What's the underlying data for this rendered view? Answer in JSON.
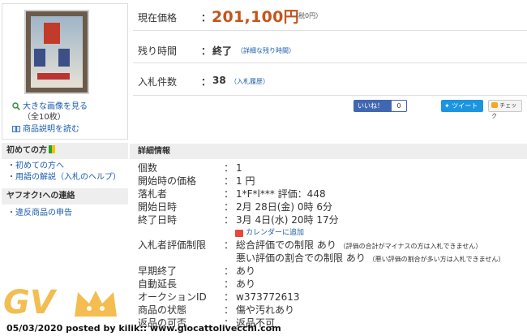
{
  "left": {
    "view_large_image": "大きな画像を見る",
    "view_large_image_count": "（全10枚）",
    "read_description": "商品説明を読む",
    "beginner": {
      "title": "初めての方",
      "items": [
        "初めての方へ",
        "用語の解説（入札のヘルプ）"
      ]
    },
    "contact": {
      "title": "ヤフオク!への連絡",
      "items": [
        "違反商品の申告"
      ]
    }
  },
  "summary": {
    "price_label": "現在価格",
    "price_value": "201,100円",
    "price_tax": "（税0円）",
    "time_label": "残り時間",
    "time_value": "終了",
    "time_detail": "（詳細な残り時間）",
    "bids_label": "入札件数",
    "bids_value": "38",
    "bids_history": "（入札履歴）"
  },
  "social": {
    "like_label": "いいね！",
    "like_count": "0",
    "tweet_label": "ツイート",
    "check_label": "チェック"
  },
  "detail": {
    "title": "詳細情報",
    "quantity_label": "個数",
    "quantity_value": "1",
    "start_price_label": "開始時の価格",
    "start_price_value": "1 円",
    "winner_label": "落札者",
    "winner_value": "1*F*l*** 評価：448",
    "start_date_label": "開始日時",
    "start_date_value": "2月 28日(金) 0時 6分",
    "end_date_label": "終了日時",
    "end_date_value": "3月 4日(水) 20時 17分",
    "calendar_link": "カレンダーに追加",
    "rating_limit_label": "入札者評価制限",
    "rating_limit_1": "総合評価での制限 あり",
    "rating_limit_1_note": "（評価の合計がマイナスの方は入札できません）",
    "rating_limit_2": "悪い評価の割合での制限 あり",
    "rating_limit_2_note": "（悪い評価の割合が多い方は入札できません）",
    "early_end_label": "早期終了",
    "early_end_value": "あり",
    "auto_extend_label": "自動延長",
    "auto_extend_value": "あり",
    "auction_id_label": "オークションID",
    "auction_id_value": "w373772613",
    "condition_label": "商品の状態",
    "condition_value": "傷や汚れあり",
    "return_label": "返品の可否",
    "return_value": "返品不可"
  },
  "watermark_text": "GV",
  "footer": "05/03/2020 posted by kilik:: www.giocattolivecchi.com",
  "colors": {
    "price": "#c4551b",
    "link": "#1a5dab",
    "section_bg": "#eeeeee",
    "like": "#4267b2",
    "tweet": "#1b95e0",
    "watermark": "#f2b233"
  }
}
